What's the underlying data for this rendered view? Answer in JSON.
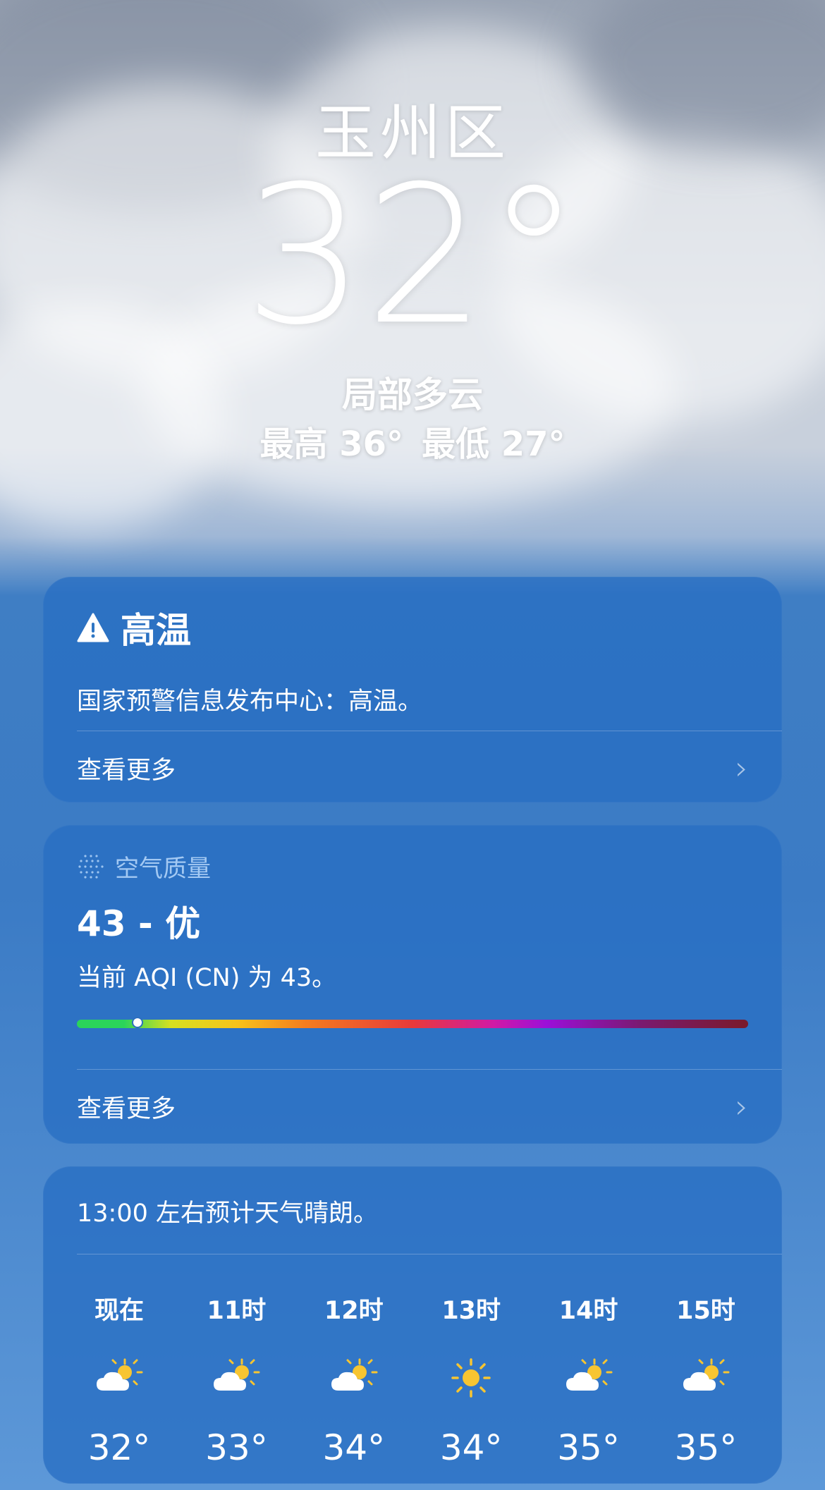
{
  "location": "玉州区",
  "current": {
    "temperature": "32°",
    "condition": "局部多云",
    "high": "最高 36°",
    "low": "最低 27°"
  },
  "alert_card": {
    "title": "高温",
    "icon": "warning-icon",
    "description": "国家预警信息发布中心：高温。",
    "more_label": "查看更多"
  },
  "air_quality": {
    "header": "空气质量",
    "icon": "air-quality-dots-icon",
    "value_label": "43 - 优",
    "description": "当前 AQI (CN) 为 43。",
    "index_fraction": 0.09,
    "more_label": "查看更多"
  },
  "hourly": {
    "forecast_text": "13:00 左右预计天气晴朗。",
    "hours": [
      {
        "label": "现在",
        "icon": "partly-cloudy-icon",
        "temp": "32°"
      },
      {
        "label": "11时",
        "icon": "partly-cloudy-icon",
        "temp": "33°"
      },
      {
        "label": "12时",
        "icon": "partly-cloudy-icon",
        "temp": "34°"
      },
      {
        "label": "13时",
        "icon": "sun-icon",
        "temp": "34°"
      },
      {
        "label": "14时",
        "icon": "partly-cloudy-icon",
        "temp": "35°"
      },
      {
        "label": "15时",
        "icon": "partly-cloudy-icon",
        "temp": "35°"
      }
    ]
  },
  "colors": {
    "card": "#2f76c4",
    "sun": "#f7c531"
  }
}
